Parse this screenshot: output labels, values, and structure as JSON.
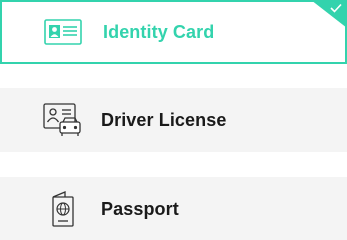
{
  "accent_color": "#33d3ad",
  "options": [
    {
      "label": "Identity Card",
      "icon": "id-card-icon",
      "selected": true
    },
    {
      "label": "Driver License",
      "icon": "driver-license-icon",
      "selected": false
    },
    {
      "label": "Passport",
      "icon": "passport-icon",
      "selected": false
    }
  ]
}
